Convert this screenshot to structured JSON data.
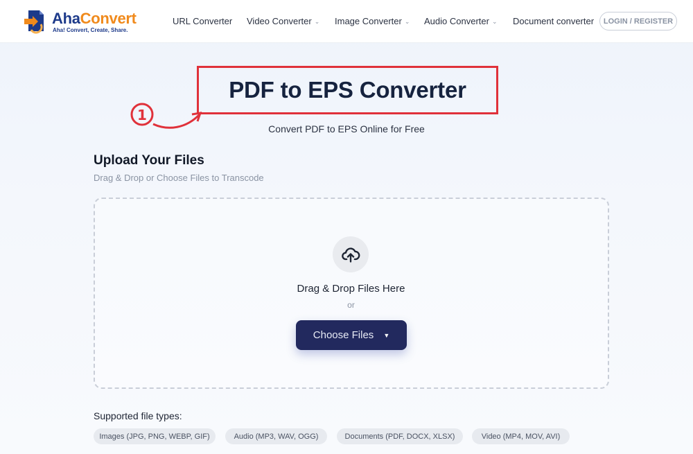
{
  "brand": {
    "name_part1": "Aha",
    "name_part2": "Convert",
    "tagline": "Aha! Convert, Create, Share.",
    "colors": {
      "primary": "#1d3a8a",
      "accent": "#f08a1c"
    }
  },
  "nav": {
    "items": [
      {
        "label": "URL Converter",
        "dropdown": false
      },
      {
        "label": "Video Converter",
        "dropdown": true
      },
      {
        "label": "Image Converter",
        "dropdown": true
      },
      {
        "label": "Audio Converter",
        "dropdown": true
      },
      {
        "label": "Document converter",
        "dropdown": false
      }
    ],
    "chevron_icon": "chevron-down-icon",
    "login_label": "LOGIN / REGISTER"
  },
  "hero": {
    "title": "PDF to EPS Converter",
    "subtitle": "Convert PDF to EPS Online for Free",
    "annotation": {
      "step_marker": "①",
      "highlight_color": "#e0313a"
    }
  },
  "upload": {
    "title": "Upload Your Files",
    "subtitle": "Drag & Drop or Choose Files to Transcode",
    "upload_icon": "cloud-upload-icon",
    "drop_text": "Drag & Drop Files Here",
    "or_text": "or",
    "choose_button": "Choose Files",
    "choose_caret": "▼",
    "button_color": "#22295e"
  },
  "supported": {
    "label": "Supported file types:",
    "types": [
      "Images (JPG, PNG, WEBP, GIF)",
      "Audio (MP3, WAV, OGG)",
      "Documents (PDF, DOCX, XLSX)",
      "Video (MP4, MOV, AVI)"
    ]
  }
}
